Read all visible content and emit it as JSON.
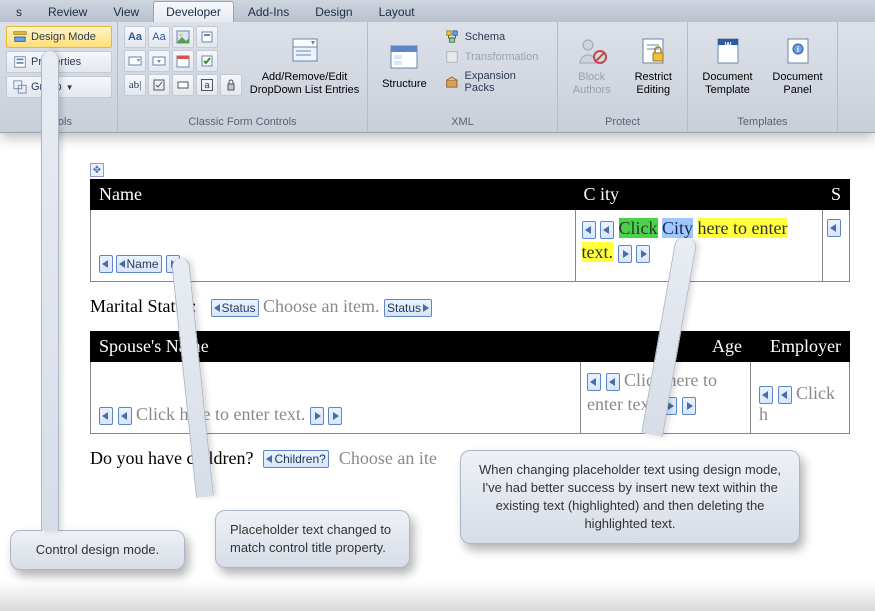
{
  "ribbon": {
    "tabs": [
      "s",
      "Review",
      "View",
      "Developer",
      "Add-Ins",
      "Design",
      "Layout"
    ],
    "activeTab": "Developer",
    "controls": {
      "designMode": "Design Mode",
      "properties": "Properties",
      "group": "Group",
      "groupLabelTruncated": "ntrols",
      "addRemove": "Add/Remove/Edit\nDropDown List Entries",
      "classicGroup": "Classic Form Controls",
      "structure": "Structure",
      "schema": "Schema",
      "transformation": "Transformation",
      "expansion": "Expansion Packs",
      "xmlGroup": "XML",
      "blockAuthors": "Block\nAuthors",
      "restrictEditing": "Restrict\nEditing",
      "protectGroup": "Protect",
      "docTemplate": "Document\nTemplate",
      "docPanel": "Document\nPanel",
      "templatesGroup": "Templates"
    }
  },
  "doc": {
    "headers1": [
      "Name",
      "C ity",
      "S"
    ],
    "nameTag": "Name",
    "clickText": "Click",
    "cityText": "City",
    "hereToEnter": "here to enter",
    "textWord": "text.",
    "maritalLabel": "Marital Status:",
    "statusTag": "Status",
    "chooseItem": "Choose an item.",
    "headers2": [
      "Spouse's Name",
      "Age",
      "Employer"
    ],
    "clickHereEnter": "Click here to enter text.",
    "clickHereTo": "Click here to",
    "enterText": "enter text.",
    "clickHTrunc": "Click h",
    "childrenLabel": "Do you have children?",
    "childrenTag": "Children?",
    "chooseTrunc": "Choose an ite",
    "childrenGhost": "Children?"
  },
  "callouts": {
    "c1": "Control design mode.",
    "c2": "Placeholder text changed to match control title property.",
    "c3": "When changing placeholder text using design mode, I've had better success by insert new text within the existing text (highlighted) and then deleting the highlighted text."
  }
}
